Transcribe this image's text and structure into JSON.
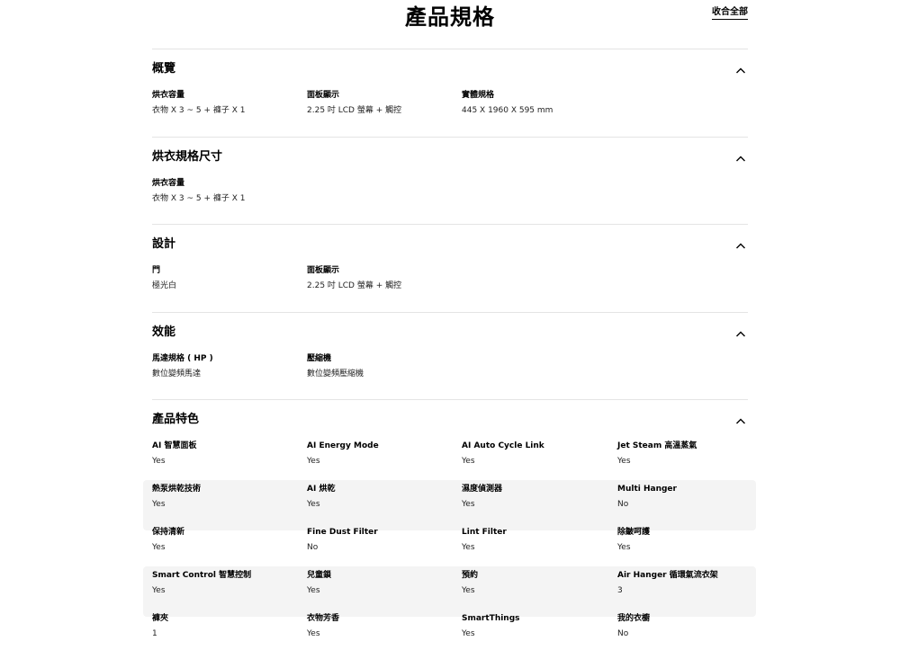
{
  "header": {
    "title": "產品規格",
    "collapse_all": "收合全部"
  },
  "sections": [
    {
      "title": "概覽",
      "items": [
        {
          "label": "烘衣容量",
          "value": "衣物 X 3 ~ 5 + 褲子 X 1"
        },
        {
          "label": "面板顯示",
          "value": "2.25 吋 LCD 螢幕 + 觸控"
        },
        {
          "label": "實體規格",
          "value": "445 X 1960 X 595 mm"
        }
      ]
    },
    {
      "title": "烘衣規格尺寸",
      "items": [
        {
          "label": "烘衣容量",
          "value": "衣物 X 3 ~ 5 + 褲子 X 1"
        }
      ]
    },
    {
      "title": "設計",
      "items": [
        {
          "label": "門",
          "value": "極光白"
        },
        {
          "label": "面板顯示",
          "value": "2.25 吋 LCD 螢幕 + 觸控"
        }
      ]
    },
    {
      "title": "效能",
      "items": [
        {
          "label": "馬達規格 ( HP )",
          "value": "數位變頻馬達"
        },
        {
          "label": "壓縮機",
          "value": "數位變頻壓縮機"
        }
      ]
    },
    {
      "title": "產品特色",
      "items": [
        {
          "label": "AI 智慧面板",
          "value": "Yes"
        },
        {
          "label": "AI Energy Mode",
          "value": "Yes"
        },
        {
          "label": "AI Auto Cycle Link",
          "value": "Yes"
        },
        {
          "label": "Jet Steam 高溫蒸氣",
          "value": "Yes"
        },
        {
          "label": "熱泵烘乾技術",
          "value": "Yes"
        },
        {
          "label": "AI 烘乾",
          "value": "Yes"
        },
        {
          "label": "濕度偵測器",
          "value": "Yes"
        },
        {
          "label": "Multi Hanger",
          "value": "No"
        },
        {
          "label": "保持清新",
          "value": "Yes"
        },
        {
          "label": "Fine Dust Filter",
          "value": "No"
        },
        {
          "label": "Lint Filter",
          "value": "Yes"
        },
        {
          "label": "除皺呵護",
          "value": "Yes"
        },
        {
          "label": "Smart Control 智慧控制",
          "value": "Yes"
        },
        {
          "label": "兒童鎖",
          "value": "Yes"
        },
        {
          "label": "預約",
          "value": "Yes"
        },
        {
          "label": "Air Hanger 循環氣流衣架",
          "value": "3"
        },
        {
          "label": "褲夾",
          "value": "1"
        },
        {
          "label": "衣物芳香",
          "value": "Yes"
        },
        {
          "label": "SmartThings",
          "value": "Yes"
        },
        {
          "label": "我的衣櫥",
          "value": "No"
        }
      ]
    }
  ]
}
